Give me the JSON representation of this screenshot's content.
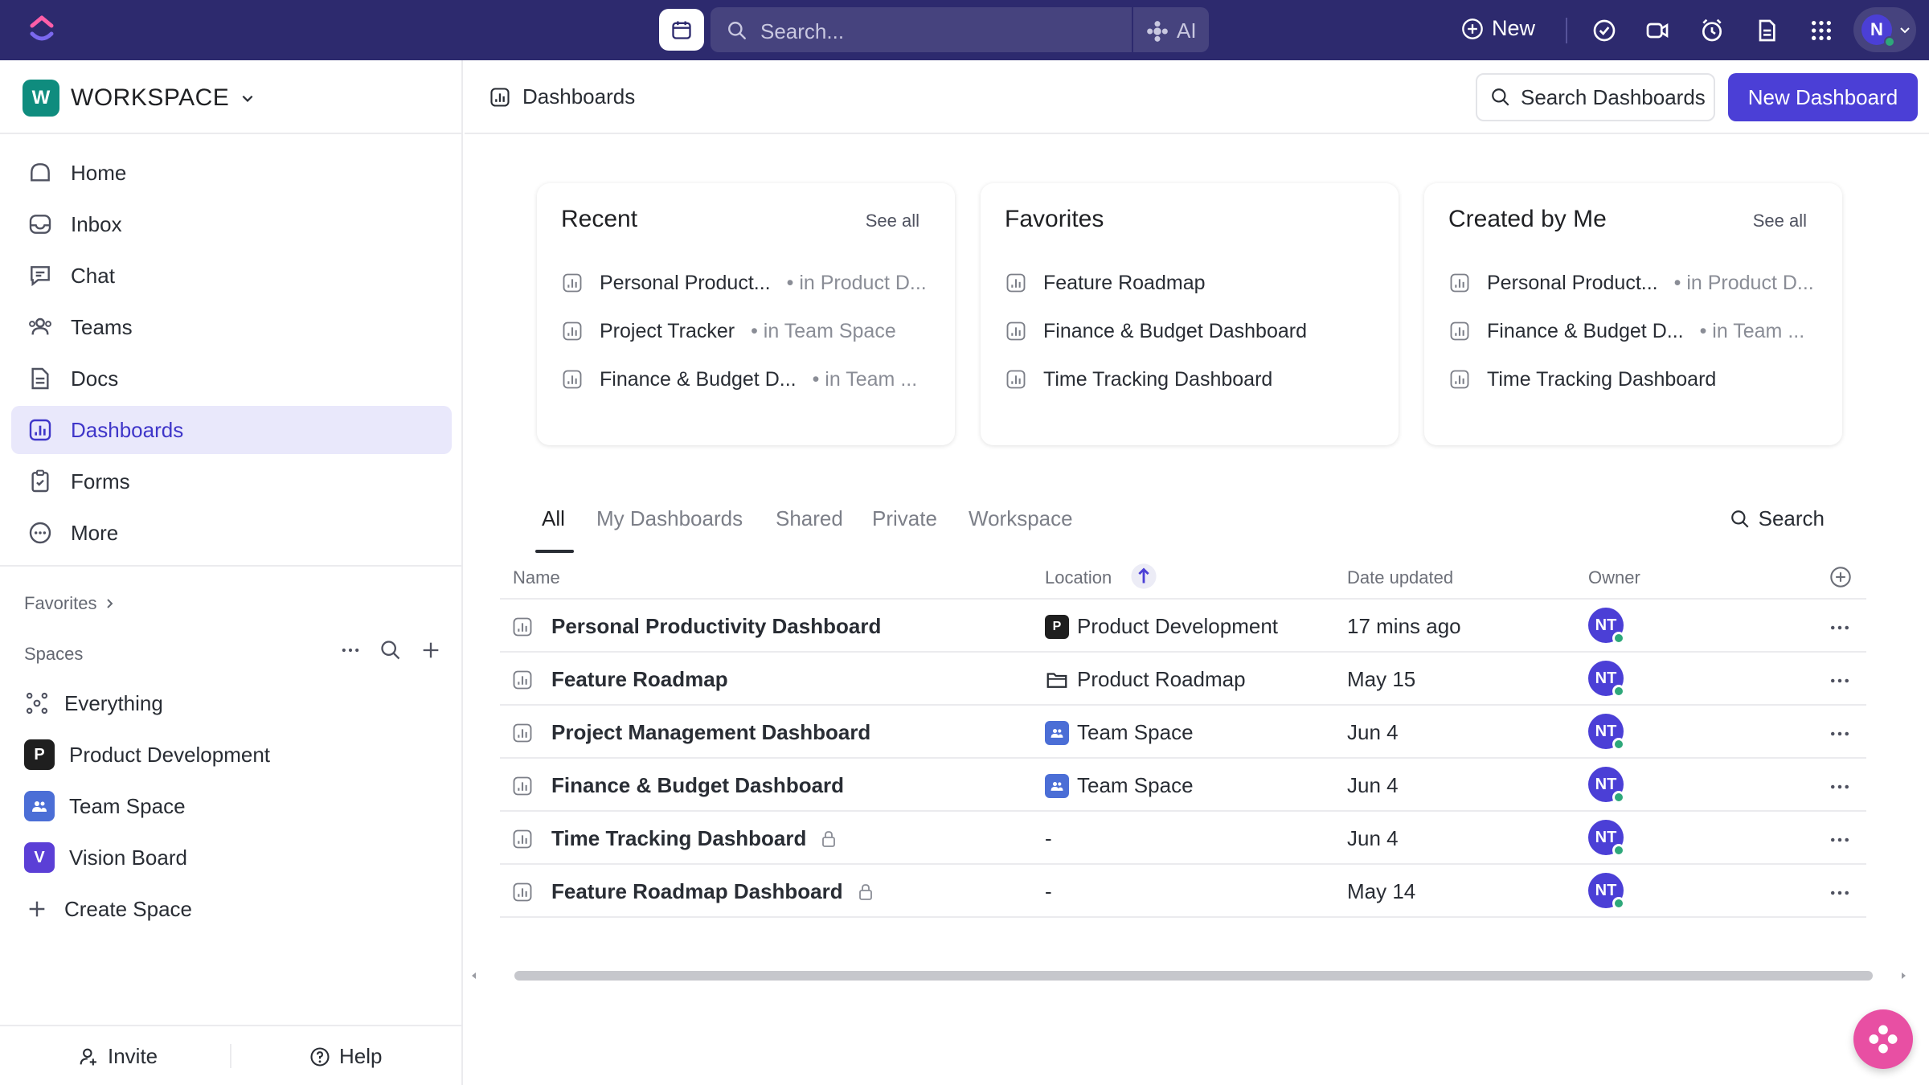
{
  "topbar": {
    "search_placeholder": "Search...",
    "ai_label": "AI",
    "new_label": "New",
    "avatar_initial": "N"
  },
  "sidebar": {
    "workspace_badge": "W",
    "workspace_name": "WORKSPACE",
    "nav": [
      {
        "label": "Home",
        "icon": "home-icon"
      },
      {
        "label": "Inbox",
        "icon": "inbox-icon"
      },
      {
        "label": "Chat",
        "icon": "chat-icon"
      },
      {
        "label": "Teams",
        "icon": "teams-icon"
      },
      {
        "label": "Docs",
        "icon": "docs-icon"
      },
      {
        "label": "Dashboards",
        "icon": "dashboard-icon"
      },
      {
        "label": "Forms",
        "icon": "forms-icon"
      },
      {
        "label": "More",
        "icon": "more-icon"
      }
    ],
    "favorites_label": "Favorites",
    "spaces_label": "Spaces",
    "spaces": [
      {
        "label": "Everything",
        "badge": ""
      },
      {
        "label": "Product Development",
        "badge": "P",
        "color": "#1f1f1f"
      },
      {
        "label": "Team Space",
        "badge": "",
        "color": "#4b6ed6"
      },
      {
        "label": "Vision Board",
        "badge": "V",
        "color": "#5b3fd6"
      },
      {
        "label": "Create Space",
        "badge": ""
      }
    ],
    "invite_label": "Invite",
    "help_label": "Help"
  },
  "header": {
    "breadcrumb": "Dashboards",
    "search_label": "Search Dashboards",
    "new_dashboard_label": "New Dashboard",
    "accent_color": "#4b3fd6"
  },
  "cards": {
    "recent": {
      "title": "Recent",
      "see_all": "See all",
      "items": [
        {
          "name": "Personal Product...",
          "loc": "• in Product D..."
        },
        {
          "name": "Project Tracker",
          "loc": "• in Team Space"
        },
        {
          "name": "Finance & Budget D...",
          "loc": "• in Team ..."
        }
      ]
    },
    "favorites": {
      "title": "Favorites",
      "items": [
        {
          "name": "Feature Roadmap"
        },
        {
          "name": "Finance & Budget Dashboard"
        },
        {
          "name": "Time Tracking Dashboard"
        }
      ]
    },
    "created": {
      "title": "Created by Me",
      "see_all": "See all",
      "items": [
        {
          "name": "Personal Product...",
          "loc": "• in Product D..."
        },
        {
          "name": "Finance & Budget D...",
          "loc": "• in Team ..."
        },
        {
          "name": "Time Tracking Dashboard",
          "loc": ""
        }
      ]
    }
  },
  "tabs": {
    "all": "All",
    "mine": "My Dashboards",
    "shared": "Shared",
    "private": "Private",
    "workspace": "Workspace",
    "search": "Search"
  },
  "table": {
    "headers": {
      "name": "Name",
      "location": "Location",
      "date": "Date updated",
      "owner": "Owner"
    },
    "rows": [
      {
        "name": "Personal Productivity Dashboard",
        "location": "Product Development",
        "loc_icon": "P",
        "date": "17 mins ago",
        "owner": "NT",
        "locked": false
      },
      {
        "name": "Feature Roadmap",
        "location": "Product Roadmap",
        "loc_icon": "folder",
        "date": "May 15",
        "owner": "NT",
        "locked": false
      },
      {
        "name": "Project Management Dashboard",
        "location": "Team Space",
        "loc_icon": "team",
        "date": "Jun 4",
        "owner": "NT",
        "locked": false
      },
      {
        "name": "Finance & Budget Dashboard",
        "location": "Team Space",
        "loc_icon": "team",
        "date": "Jun 4",
        "owner": "NT",
        "locked": false
      },
      {
        "name": "Time Tracking Dashboard",
        "location": "-",
        "loc_icon": "",
        "date": "Jun 4",
        "owner": "NT",
        "locked": true
      },
      {
        "name": "Feature Roadmap Dashboard",
        "location": "-",
        "loc_icon": "",
        "date": "May 14",
        "owner": "NT",
        "locked": true
      }
    ]
  }
}
